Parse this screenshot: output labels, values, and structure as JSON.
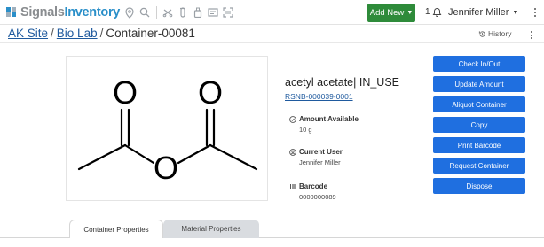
{
  "app": {
    "logo_part1": "Signals",
    "logo_part2": "Inventory",
    "brand_color": "#2a8fc9"
  },
  "toolbar": {
    "icons": [
      "location-icon",
      "search-icon",
      "scale-icon",
      "tube-icon",
      "bottle-icon",
      "list-icon",
      "scan-icon"
    ],
    "add_new_label": "Add New",
    "add_new_color": "#2e8b3a",
    "notification_count": "1",
    "user_name": "Jennifer Miller"
  },
  "breadcrumb": {
    "site": "AK Site",
    "lab": "Bio Lab",
    "container": "Container-00081",
    "separator": "/",
    "history_label": "History"
  },
  "detail": {
    "compound_name": "acetyl acetate| IN_USE",
    "reference": "RSNB-000039-0001",
    "amount_label": "Amount Available",
    "amount_value": "10 g",
    "user_label": "Current User",
    "user_value": "Jennifer Miller",
    "barcode_label": "Barcode",
    "barcode_value": "0000000089"
  },
  "actions": {
    "color": "#1f6fe0",
    "buttons": [
      "Check In/Out",
      "Update Amount",
      "Aliquot Container",
      "Copy",
      "Print Barcode",
      "Request Container",
      "Dispose"
    ]
  },
  "structure": {
    "atom_labels": [
      "O",
      "O",
      "O"
    ]
  },
  "tabs": {
    "items": [
      "Container Properties",
      "Material Properties"
    ],
    "active": "Container Properties"
  }
}
